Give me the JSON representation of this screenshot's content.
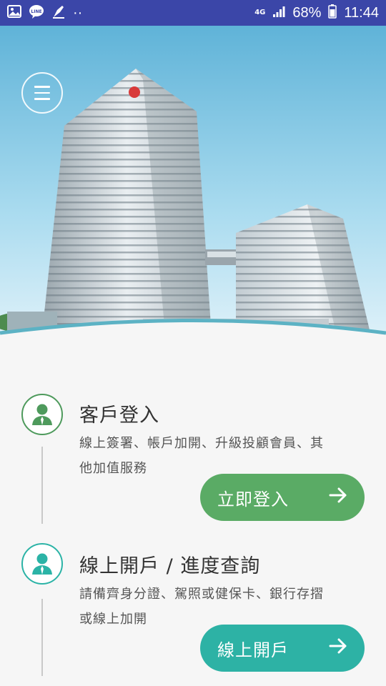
{
  "status_bar": {
    "left_icons": [
      "image-icon",
      "line-app-icon",
      "pen-nib-icon",
      "more-dots-icon"
    ],
    "dots": "··",
    "network": "4G",
    "battery": "68%",
    "time": "11:44"
  },
  "hero": {
    "menu_icon": "hamburger-menu-icon"
  },
  "sections": [
    {
      "icon": "person-icon",
      "title": "客戶登入",
      "description": "線上簽署、帳戶加開、升級投顧會員、其他加值服務",
      "button_label": "立即登入",
      "button_icon": "arrow-right-icon",
      "accent": "#5aab65"
    },
    {
      "icon": "person-icon",
      "title": "線上開戶 / 進度查詢",
      "description": "請備齊身分證、駕照或健保卡、銀行存摺或線上加開",
      "button_label": "線上開戶",
      "button_icon": "arrow-right-icon",
      "accent": "#2db2a5"
    }
  ]
}
